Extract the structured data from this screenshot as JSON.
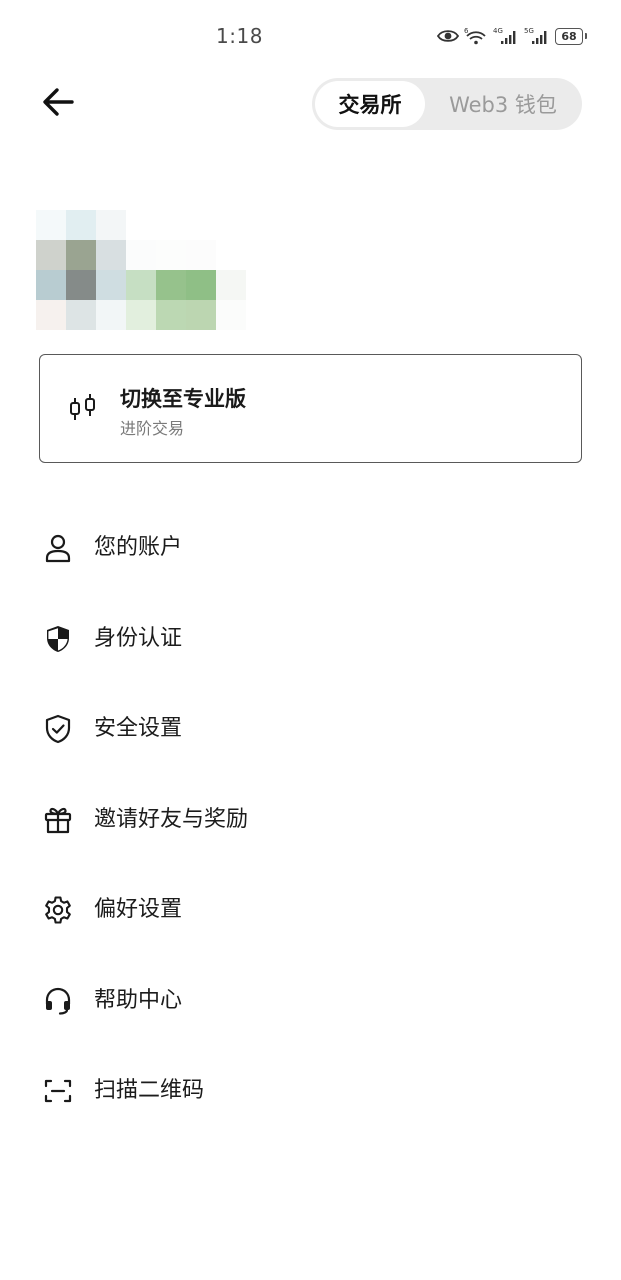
{
  "status_bar": {
    "time": "1:18",
    "battery": "68",
    "icons": [
      "eye-icon",
      "wifi-icon",
      "signal-4g-icon",
      "signal-5g-icon",
      "battery-icon"
    ]
  },
  "header": {
    "back_icon": "arrow-left-icon",
    "tabs": [
      {
        "label": "交易所",
        "active": true
      },
      {
        "label": "Web3 钱包",
        "active": false
      }
    ]
  },
  "pro_card": {
    "title": "切换至专业版",
    "subtitle": "进阶交易",
    "icon": "candlestick-icon"
  },
  "menu": {
    "items": [
      {
        "label": "您的账户",
        "icon": "user-icon"
      },
      {
        "label": "身份认证",
        "icon": "shield-half-icon"
      },
      {
        "label": "安全设置",
        "icon": "shield-check-icon"
      },
      {
        "label": "邀请好友与奖励",
        "icon": "gift-icon"
      },
      {
        "label": "偏好设置",
        "icon": "gear-icon"
      },
      {
        "label": "帮助中心",
        "icon": "headset-icon"
      },
      {
        "label": "扫描二维码",
        "icon": "scan-icon"
      }
    ]
  },
  "colors": {
    "text_primary": "#1a1a1a",
    "text_secondary": "#7a7a7a",
    "tab_inactive": "#9a9a9a",
    "segment_bg": "#ebebeb",
    "card_border": "#595959"
  }
}
